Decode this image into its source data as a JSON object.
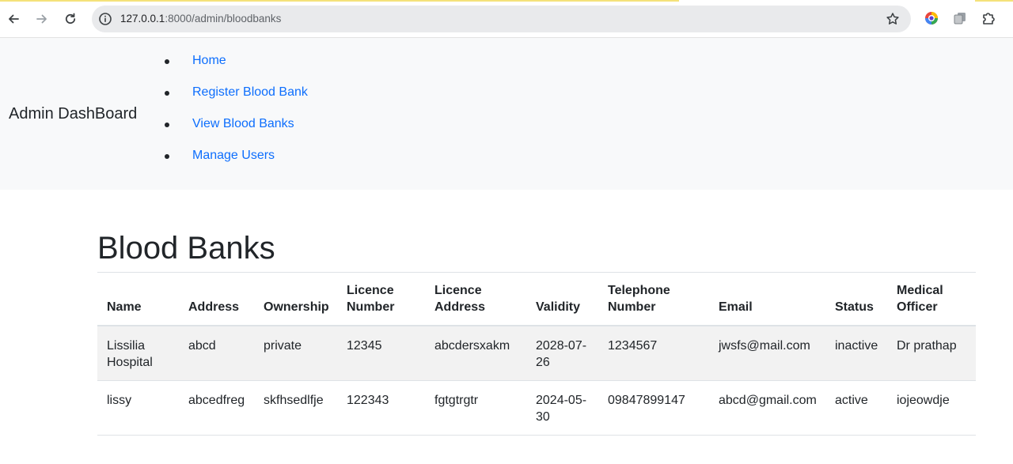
{
  "browser": {
    "url_host": "127.0.0.1",
    "url_path": ":8000/admin/bloodbanks"
  },
  "navbar": {
    "brand": "Admin DashBoard",
    "links": [
      {
        "label": "Home"
      },
      {
        "label": "Register Blood Bank"
      },
      {
        "label": "View Blood Banks"
      },
      {
        "label": "Manage Users"
      }
    ]
  },
  "page": {
    "title": "Blood Banks"
  },
  "table": {
    "headers": [
      "Name",
      "Address",
      "Ownership",
      "Licence Number",
      "Licence Address",
      "Validity",
      "Telephone Number",
      "Email",
      "Status",
      "Medical Officer"
    ],
    "rows": [
      [
        "Lissilia Hospital",
        "abcd",
        "private",
        "12345",
        "abcdersxakm",
        "2028-07-26",
        "1234567",
        "jwsfs@mail.com",
        "inactive",
        "Dr prathap"
      ],
      [
        "lissy",
        "abcedfreg",
        "skfhsedlfje",
        "122343",
        "fgtgtrgtr",
        "2024-05-30",
        "09847899147",
        "abcd@gmail.com",
        "active",
        "iojeowdje"
      ]
    ]
  },
  "colors": {
    "link": "#0d6efd",
    "navbar_bg": "#f8f9fa",
    "stripe": "#f2f2f2"
  }
}
